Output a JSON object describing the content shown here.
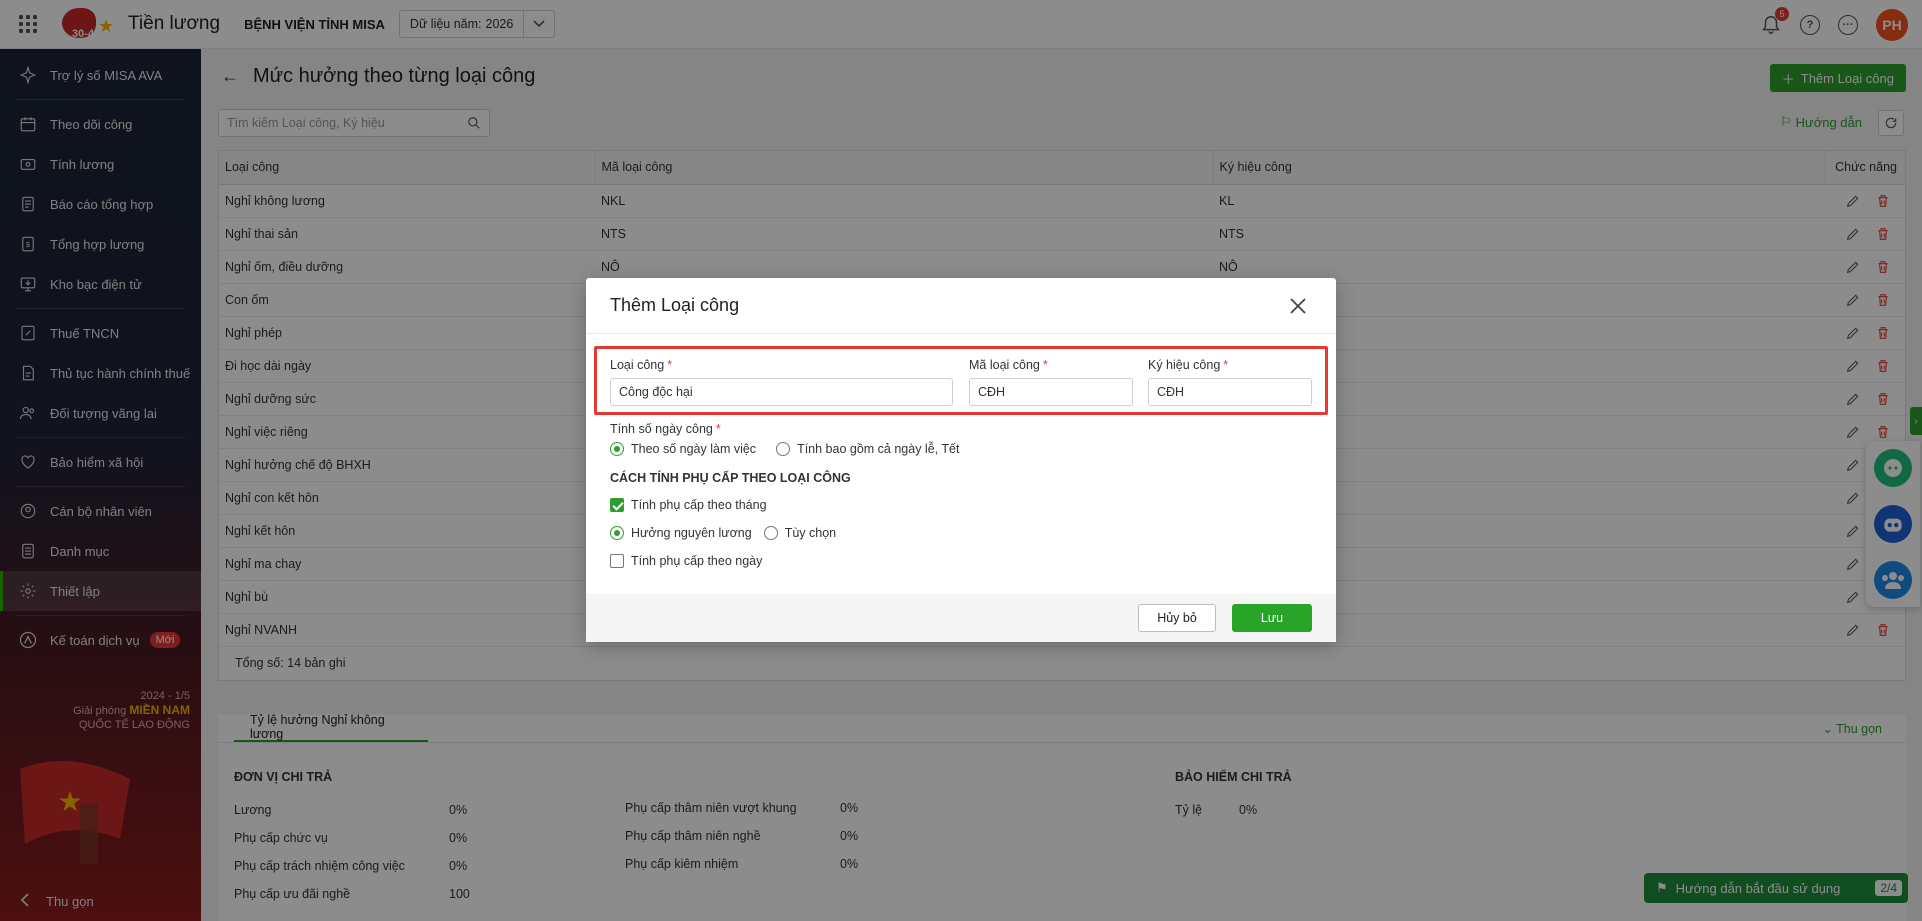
{
  "app": {
    "title": "Tiền lương",
    "org": "BỆNH VIỆN TỈNH MISA",
    "year_label": "Dữ liệu năm:",
    "year_value": "2026",
    "logo_text": "30-4",
    "notif_count": "5",
    "avatar_initials": "PH"
  },
  "sidebar": {
    "items": [
      {
        "label": "Trợ lý số MISA AVA",
        "icon": "sparkle-icon"
      },
      {
        "label": "Theo dõi công",
        "icon": "calendar-icon"
      },
      {
        "label": "Tính lương",
        "icon": "money-icon"
      },
      {
        "label": "Báo cáo tổng hợp",
        "icon": "report-icon"
      },
      {
        "label": "Tổng hợp lương",
        "icon": "salary-summary-icon"
      },
      {
        "label": "Kho bạc điện tử",
        "icon": "treasury-icon"
      },
      {
        "label": "Thuế TNCN",
        "icon": "tax-icon"
      },
      {
        "label": "Thủ tục hành chính thuế",
        "icon": "document-icon"
      },
      {
        "label": "Đối tượng vãng lai",
        "icon": "people-icon"
      },
      {
        "label": "Bảo hiểm xã hội",
        "icon": "insurance-icon"
      },
      {
        "label": "Cán bộ nhân viên",
        "icon": "staff-icon"
      },
      {
        "label": "Danh mục",
        "icon": "list-icon"
      },
      {
        "label": "Thiết lập",
        "icon": "gear-icon"
      },
      {
        "label": "Kế toán dịch vụ",
        "icon": "accounting-icon",
        "badge": "Mới"
      }
    ],
    "collapse_label": "Thu gọn",
    "banner": {
      "line1": "2024 - 1/5",
      "line2_a": "Giải phóng ",
      "line2_b": "MIỀN NAM",
      "line3": "QUỐC TẾ LAO ĐỘNG"
    }
  },
  "page": {
    "title": "Mức hưởng theo từng loại công",
    "add_button": "Thêm Loại công",
    "search_placeholder": "Tìm kiếm Loại công, Ký hiệu",
    "guide_link": "Hướng dẫn"
  },
  "table": {
    "columns": [
      "Loại công",
      "Mã loại công",
      "Ký hiệu công",
      "Chức năng"
    ],
    "rows": [
      [
        "Nghỉ không lương",
        "NKL",
        "KL"
      ],
      [
        "Nghỉ thai sản",
        "NTS",
        "NTS"
      ],
      [
        "Nghỉ ốm, điều dưỡng",
        "NÔ",
        "NÔ"
      ],
      [
        "Con ốm",
        "",
        ""
      ],
      [
        "Nghỉ phép",
        "",
        ""
      ],
      [
        "Đi học dài ngày",
        "",
        ""
      ],
      [
        "Nghỉ dưỡng sức",
        "",
        ""
      ],
      [
        "Nghỉ việc riêng",
        "",
        ""
      ],
      [
        "Nghỉ hưởng chế độ BHXH",
        "",
        ""
      ],
      [
        "Nghỉ con kết hôn",
        "",
        ""
      ],
      [
        "Nghỉ kết hôn",
        "",
        ""
      ],
      [
        "Nghỉ ma chay",
        "",
        ""
      ],
      [
        "Nghỉ bù",
        "",
        ""
      ],
      [
        "Nghỉ NVANH",
        "",
        ""
      ]
    ],
    "total": "Tổng số: 14 bản ghi"
  },
  "bottom": {
    "tab": "Tỷ lệ hưởng Nghỉ không lương",
    "collapse": "Thu gọn",
    "col1_title": "ĐƠN VỊ CHI TRẢ",
    "col1": [
      [
        "Lương",
        "0%"
      ],
      [
        "Phụ cấp chức vụ",
        "0%"
      ],
      [
        "Phụ cấp trách nhiệm công việc",
        "0%"
      ],
      [
        "Phụ cấp ưu đãi nghề",
        "100"
      ]
    ],
    "col2": [
      [
        "Phụ cấp thâm niên vượt khung",
        "0%"
      ],
      [
        "Phụ cấp thâm niên nghề",
        "0%"
      ],
      [
        "Phụ cấp kiêm nhiệm",
        "0%"
      ]
    ],
    "col3_title": "BẢO HIỂM CHI TRẢ",
    "col3": [
      [
        "Tỷ lệ",
        "0%"
      ]
    ]
  },
  "modal": {
    "title": "Thêm Loại công",
    "f1_label": "Loại công",
    "f1_value": "Công độc hại",
    "f2_label": "Mã loại công",
    "f2_value": "CĐH",
    "f3_label": "Ký hiệu công",
    "f3_value": "CĐH",
    "req": "*",
    "days_label": "Tính số ngày công",
    "days_opt1": "Theo số ngày làm việc",
    "days_opt2": "Tính bao gồm cả ngày lễ, Tết",
    "allow_title": "CÁCH TÍNH PHỤ CẤP THEO LOẠI CÔNG",
    "chk_month": "Tính phụ cấp theo tháng",
    "opt_full": "Hưởng nguyên lương",
    "opt_custom": "Tùy chọn",
    "chk_day": "Tính phụ cấp theo ngày",
    "cancel": "Hủy bỏ",
    "save": "Lưu"
  },
  "guide_bar": {
    "label": "Hướng dẫn bắt đầu sử dụng",
    "count": "2/4"
  },
  "colors": {
    "accent": "#2e9e2e",
    "danger": "#e53935",
    "sidebar_bg": "#1f2437"
  }
}
